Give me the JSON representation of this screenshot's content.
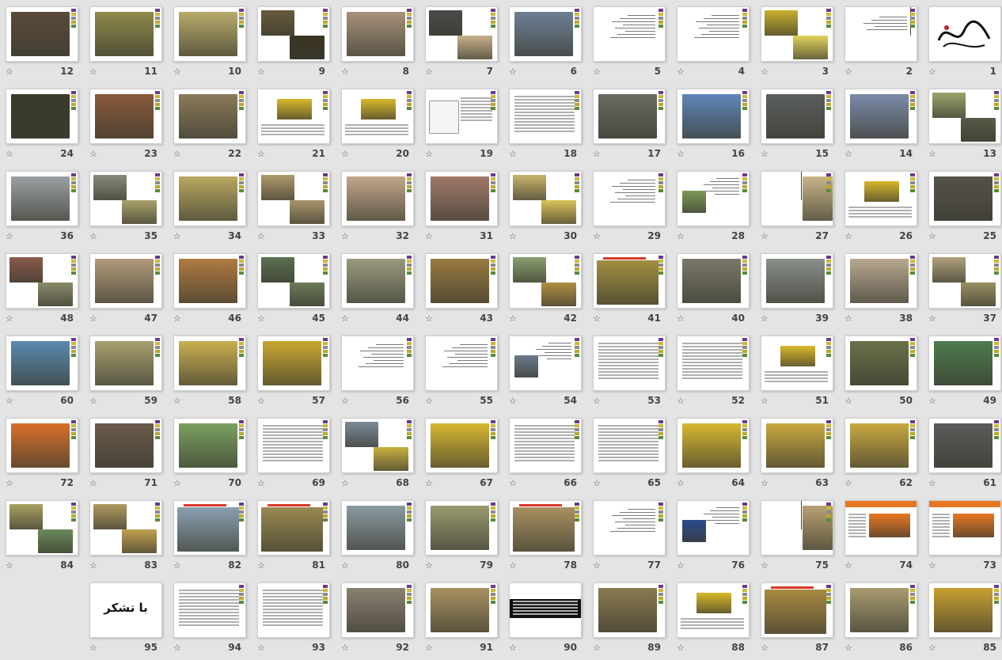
{
  "slides": [
    {
      "number": "1",
      "kind": "calligraphy"
    },
    {
      "number": "2",
      "kind": "text-cross"
    },
    {
      "number": "3",
      "kind": "photo-duo",
      "colors": [
        "#c9b02e",
        "#e0d25a"
      ]
    },
    {
      "number": "4",
      "kind": "text"
    },
    {
      "number": "5",
      "kind": "text"
    },
    {
      "number": "6",
      "kind": "photo",
      "colors": [
        "#6e7f95"
      ]
    },
    {
      "number": "7",
      "kind": "photo-duo",
      "colors": [
        "#4a4a4a",
        "#c8b08a"
      ]
    },
    {
      "number": "8",
      "kind": "photo",
      "colors": [
        "#a8927a"
      ]
    },
    {
      "number": "9",
      "kind": "photo-duo",
      "colors": [
        "#6a5a3a",
        "#3a3320"
      ]
    },
    {
      "number": "10",
      "kind": "photo",
      "colors": [
        "#b8ab6a"
      ]
    },
    {
      "number": "11",
      "kind": "photo",
      "colors": [
        "#8f8a4a"
      ]
    },
    {
      "number": "12",
      "kind": "photo",
      "colors": [
        "#5a4a3a"
      ]
    },
    {
      "number": "13",
      "kind": "photo-duo",
      "colors": [
        "#9aa36a",
        "#5a5a48"
      ]
    },
    {
      "number": "14",
      "kind": "photo",
      "colors": [
        "#7a8aa8"
      ]
    },
    {
      "number": "15",
      "kind": "photo",
      "colors": [
        "#5a5e5c"
      ]
    },
    {
      "number": "16",
      "kind": "photo",
      "colors": [
        "#5f86b8"
      ]
    },
    {
      "number": "17",
      "kind": "photo",
      "colors": [
        "#6b6b62"
      ]
    },
    {
      "number": "18",
      "kind": "table"
    },
    {
      "number": "19",
      "kind": "chart"
    },
    {
      "number": "20",
      "kind": "diagram",
      "colors": [
        "#d9b82a"
      ]
    },
    {
      "number": "21",
      "kind": "diagram",
      "colors": [
        "#d9b82a"
      ]
    },
    {
      "number": "22",
      "kind": "photo",
      "colors": [
        "#8a7a5a"
      ]
    },
    {
      "number": "23",
      "kind": "photo",
      "colors": [
        "#8a5a3a"
      ]
    },
    {
      "number": "24",
      "kind": "photo",
      "colors": [
        "#3a3a2a"
      ]
    },
    {
      "number": "25",
      "kind": "photo",
      "colors": [
        "#55524c"
      ]
    },
    {
      "number": "26",
      "kind": "diagram",
      "colors": [
        "#d9b82a"
      ]
    },
    {
      "number": "27",
      "kind": "photo-side",
      "colors": [
        "#c9b488"
      ]
    },
    {
      "number": "28",
      "kind": "text-photo",
      "colors": [
        "#7f9a58"
      ]
    },
    {
      "number": "29",
      "kind": "text"
    },
    {
      "number": "30",
      "kind": "photo-duo",
      "colors": [
        "#c9b46a",
        "#d9c25a"
      ]
    },
    {
      "number": "31",
      "kind": "photo",
      "colors": [
        "#a07a6a"
      ]
    },
    {
      "number": "32",
      "kind": "photo",
      "colors": [
        "#c2a68a"
      ]
    },
    {
      "number": "33",
      "kind": "photo-duo",
      "colors": [
        "#b09a6a",
        "#a8946a"
      ]
    },
    {
      "number": "34",
      "kind": "photo",
      "colors": [
        "#b8a860"
      ]
    },
    {
      "number": "35",
      "kind": "photo-duo",
      "colors": [
        "#8a8a7a",
        "#a8a06a"
      ]
    },
    {
      "number": "36",
      "kind": "photo",
      "colors": [
        "#9aa0a2"
      ]
    },
    {
      "number": "37",
      "kind": "photo-duo",
      "colors": [
        "#b0a07a",
        "#9a9060"
      ]
    },
    {
      "number": "38",
      "kind": "photo",
      "colors": [
        "#b8a890"
      ]
    },
    {
      "number": "39",
      "kind": "photo",
      "colors": [
        "#8a8f8a"
      ]
    },
    {
      "number": "40",
      "kind": "photo",
      "colors": [
        "#7a786a"
      ]
    },
    {
      "number": "41",
      "kind": "photo-titled",
      "colors": [
        "#a08f40"
      ]
    },
    {
      "number": "42",
      "kind": "photo-duo",
      "colors": [
        "#8aa070",
        "#b09040"
      ]
    },
    {
      "number": "43",
      "kind": "photo",
      "colors": [
        "#9a7a40"
      ]
    },
    {
      "number": "44",
      "kind": "photo",
      "colors": [
        "#9a9a80"
      ]
    },
    {
      "number": "45",
      "kind": "photo-duo",
      "colors": [
        "#5a7050",
        "#6a7a5a"
      ]
    },
    {
      "number": "46",
      "kind": "photo",
      "colors": [
        "#b07a40"
      ]
    },
    {
      "number": "47",
      "kind": "photo",
      "colors": [
        "#b09a7a"
      ]
    },
    {
      "number": "48",
      "kind": "photo-duo",
      "colors": [
        "#8a5a4a",
        "#8a8a6a"
      ]
    },
    {
      "number": "49",
      "kind": "photo",
      "colors": [
        "#4e7a4e"
      ]
    },
    {
      "number": "50",
      "kind": "photo",
      "colors": [
        "#6a7048"
      ]
    },
    {
      "number": "51",
      "kind": "diagram",
      "colors": [
        "#d9b82a"
      ]
    },
    {
      "number": "52",
      "kind": "table"
    },
    {
      "number": "53",
      "kind": "table"
    },
    {
      "number": "54",
      "kind": "text-photo",
      "colors": [
        "#6a7a8a"
      ]
    },
    {
      "number": "55",
      "kind": "text"
    },
    {
      "number": "56",
      "kind": "text"
    },
    {
      "number": "57",
      "kind": "photo",
      "colors": [
        "#c9a830"
      ]
    },
    {
      "number": "58",
      "kind": "photo",
      "colors": [
        "#c9b050"
      ]
    },
    {
      "number": "59",
      "kind": "photo",
      "colors": [
        "#a8a070"
      ]
    },
    {
      "number": "60",
      "kind": "photo",
      "colors": [
        "#5a8ab0"
      ]
    },
    {
      "number": "61",
      "kind": "photo",
      "colors": [
        "#5a5a5a"
      ]
    },
    {
      "number": "62",
      "kind": "photo",
      "colors": [
        "#c9a840"
      ]
    },
    {
      "number": "63",
      "kind": "photo",
      "colors": [
        "#c9a840"
      ]
    },
    {
      "number": "64",
      "kind": "photo",
      "colors": [
        "#d9b830"
      ]
    },
    {
      "number": "65",
      "kind": "table"
    },
    {
      "number": "66",
      "kind": "table"
    },
    {
      "number": "67",
      "kind": "photo",
      "colors": [
        "#d9b830"
      ]
    },
    {
      "number": "68",
      "kind": "photo-duo",
      "colors": [
        "#7a8a9a",
        "#c9b040"
      ]
    },
    {
      "number": "69",
      "kind": "table"
    },
    {
      "number": "70",
      "kind": "photo",
      "colors": [
        "#7aa060"
      ]
    },
    {
      "number": "71",
      "kind": "photo",
      "colors": [
        "#6a5a4a"
      ]
    },
    {
      "number": "72",
      "kind": "photo",
      "colors": [
        "#d8702a"
      ]
    },
    {
      "number": "73",
      "kind": "diagram-orange",
      "colors": [
        "#e87722"
      ]
    },
    {
      "number": "74",
      "kind": "diagram-orange",
      "colors": [
        "#e87722"
      ]
    },
    {
      "number": "75",
      "kind": "photo-side",
      "colors": [
        "#b8a070"
      ]
    },
    {
      "number": "76",
      "kind": "text-photo",
      "colors": [
        "#2b4a8b"
      ]
    },
    {
      "number": "77",
      "kind": "text"
    },
    {
      "number": "78",
      "kind": "photo-titled",
      "colors": [
        "#a89060"
      ]
    },
    {
      "number": "79",
      "kind": "photo",
      "colors": [
        "#9a9a70"
      ]
    },
    {
      "number": "80",
      "kind": "photo",
      "colors": [
        "#8a9aa0"
      ]
    },
    {
      "number": "81",
      "kind": "photo-titled",
      "colors": [
        "#9a8a50"
      ]
    },
    {
      "number": "82",
      "kind": "photo-titled",
      "colors": [
        "#8aa0b0"
      ]
    },
    {
      "number": "83",
      "kind": "photo-duo",
      "colors": [
        "#b09a60",
        "#c0a050"
      ]
    },
    {
      "number": "84",
      "kind": "photo-duo",
      "colors": [
        "#a8a060",
        "#6a8a5a"
      ]
    },
    {
      "number": "85",
      "kind": "photo",
      "colors": [
        "#c9a030"
      ]
    },
    {
      "number": "86",
      "kind": "photo",
      "colors": [
        "#a89a70"
      ]
    },
    {
      "number": "87",
      "kind": "photo-titled",
      "colors": [
        "#a88a40"
      ]
    },
    {
      "number": "88",
      "kind": "diagram",
      "colors": [
        "#d9b82a"
      ]
    },
    {
      "number": "89",
      "kind": "photo",
      "colors": [
        "#8a7a50"
      ]
    },
    {
      "number": "90",
      "kind": "table-dark"
    },
    {
      "number": "91",
      "kind": "photo",
      "colors": [
        "#a89060"
      ]
    },
    {
      "number": "92",
      "kind": "photo",
      "colors": [
        "#8a8070"
      ]
    },
    {
      "number": "93",
      "kind": "table"
    },
    {
      "number": "94",
      "kind": "table"
    },
    {
      "number": "95",
      "kind": "thanks",
      "text": "با تشکر"
    }
  ],
  "star_symbol": "☆",
  "theme": {
    "background": "#e4e4e4",
    "slide_bg": "#ffffff",
    "number_color": "#444444",
    "accent_bar": [
      "#6a3a8a",
      "#c9b83a",
      "#8a8a8a",
      "#b8a82a",
      "#5a8a3a"
    ]
  }
}
